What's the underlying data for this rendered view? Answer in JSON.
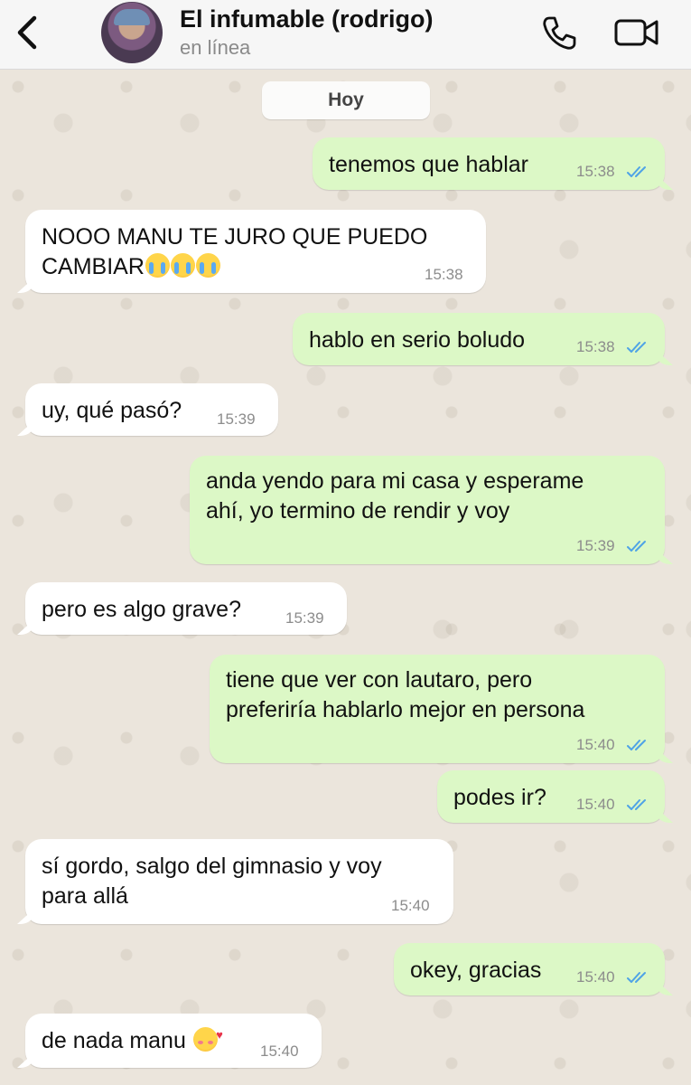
{
  "header": {
    "contact_name": "El infumable (rodrigo)",
    "status": "en línea",
    "icons": {
      "back": "chevron-left-icon",
      "call": "phone-icon",
      "video": "video-camera-icon"
    }
  },
  "date_separator": "Hoy",
  "messages": [
    {
      "dir": "out",
      "text": "tenemos que hablar",
      "time": "15:38",
      "ticks": "read"
    },
    {
      "dir": "in",
      "text": "NOOO MANU TE JURO QUE PUEDO\nCAMBIAR",
      "emoji": "loudly-crying-face-x3",
      "time": "15:38"
    },
    {
      "dir": "out",
      "text": "hablo en serio boludo",
      "time": "15:38",
      "ticks": "read"
    },
    {
      "dir": "in",
      "text": "uy, qué pasó?",
      "time": "15:39"
    },
    {
      "dir": "out",
      "text": "anda yendo para mi casa y esperame\nahí, yo termino de rendir y voy",
      "time": "15:39",
      "ticks": "read"
    },
    {
      "dir": "in",
      "text": "pero es algo grave?",
      "time": "15:39"
    },
    {
      "dir": "out",
      "text": "tiene que ver con lautaro, pero\npreferiría hablarlo mejor en persona",
      "time": "15:40",
      "ticks": "read"
    },
    {
      "dir": "out",
      "text": "podes ir?",
      "time": "15:40",
      "ticks": "read"
    },
    {
      "dir": "in",
      "text": "sí gordo, salgo del gimnasio y voy\npara allá",
      "time": "15:40"
    },
    {
      "dir": "out",
      "text": "okey, gracias",
      "time": "15:40",
      "ticks": "read"
    },
    {
      "dir": "in",
      "text": "de nada manu",
      "emoji": "smiling-face-with-hearts",
      "time": "15:40"
    }
  ],
  "colors": {
    "outgoing_bubble": "#dcf8c6",
    "incoming_bubble": "#ffffff",
    "read_ticks": "#4fa3e6"
  }
}
